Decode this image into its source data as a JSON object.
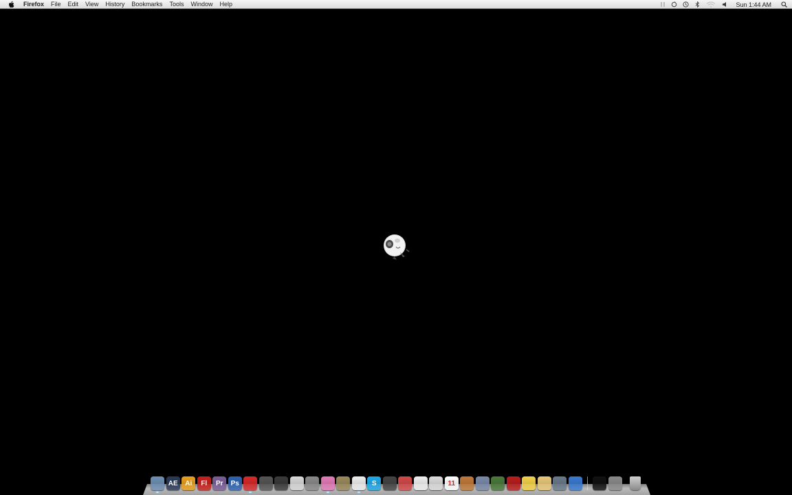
{
  "menubar": {
    "apple_icon": "apple-logo-icon",
    "app_name": "Firefox",
    "items": [
      "File",
      "Edit",
      "View",
      "History",
      "Bookmarks",
      "Tools",
      "Window",
      "Help"
    ],
    "clock": "Sun 1:44 AM",
    "status_icons": [
      "pause-bars-icon",
      "sync-icon",
      "time-machine-icon",
      "bluetooth-icon",
      "wifi-icon",
      "volume-icon",
      "spotlight-search-icon"
    ]
  },
  "desktop": {
    "background": "#000000",
    "center_icon": "loading-panda-icon"
  },
  "dock": {
    "items": [
      {
        "name": "finder",
        "label": "",
        "color": "#6f8fb3",
        "running": true
      },
      {
        "name": "after-effects",
        "label": "AE",
        "color": "#2b3a55",
        "running": false
      },
      {
        "name": "illustrator",
        "label": "Ai",
        "color": "#e8a020",
        "running": false
      },
      {
        "name": "flash",
        "label": "Fl",
        "color": "#c8211e",
        "running": false
      },
      {
        "name": "premiere",
        "label": "Pr",
        "color": "#7a5e96",
        "running": false
      },
      {
        "name": "photoshop",
        "label": "Ps",
        "color": "#2f64b0",
        "running": false
      },
      {
        "name": "mushroom",
        "label": "",
        "color": "#d62a2a",
        "running": true
      },
      {
        "name": "toolbox",
        "label": "",
        "color": "#555555",
        "running": false
      },
      {
        "name": "quicktime",
        "label": "",
        "color": "#3a3a3a",
        "running": false
      },
      {
        "name": "cube",
        "label": "",
        "color": "#d8d8d8",
        "running": false
      },
      {
        "name": "sync",
        "label": "",
        "color": "#8a8a8a",
        "running": false
      },
      {
        "name": "pink-app",
        "label": "",
        "color": "#e47bb8",
        "running": true
      },
      {
        "name": "gimp",
        "label": "",
        "color": "#9a8a5c",
        "running": false
      },
      {
        "name": "panda",
        "label": "",
        "color": "#eeeeee",
        "running": true
      },
      {
        "name": "skype",
        "label": "S",
        "color": "#21a9e6",
        "running": false
      },
      {
        "name": "send",
        "label": "",
        "color": "#444444",
        "running": false
      },
      {
        "name": "growl",
        "label": "",
        "color": "#d24a4a",
        "running": false
      },
      {
        "name": "document",
        "label": "",
        "color": "#f0f0f0",
        "running": false
      },
      {
        "name": "notes",
        "label": "",
        "color": "#dcdcdc",
        "running": false
      },
      {
        "name": "calendar",
        "label": "11",
        "color": "#ffffff",
        "running": false
      },
      {
        "name": "keynote",
        "label": "",
        "color": "#c07a3a",
        "running": false
      },
      {
        "name": "pen",
        "label": "",
        "color": "#7a8aa8",
        "running": false
      },
      {
        "name": "graph",
        "label": "",
        "color": "#4a7a3a",
        "running": false
      },
      {
        "name": "red-book",
        "label": "",
        "color": "#b81e1e",
        "running": false
      },
      {
        "name": "stickies",
        "label": "",
        "color": "#f2d24a",
        "running": false
      },
      {
        "name": "folder",
        "label": "",
        "color": "#e8c87a",
        "running": false
      },
      {
        "name": "trash-app",
        "label": "",
        "color": "#6a7a8a",
        "running": false
      },
      {
        "name": "safari",
        "label": "",
        "color": "#3a7ad0",
        "running": false
      }
    ],
    "right_items": [
      {
        "name": "black-app",
        "label": "",
        "color": "#111111"
      },
      {
        "name": "system-preferences",
        "label": "",
        "color": "#8a8a8a"
      }
    ],
    "trash_icon": "trash-icon"
  }
}
